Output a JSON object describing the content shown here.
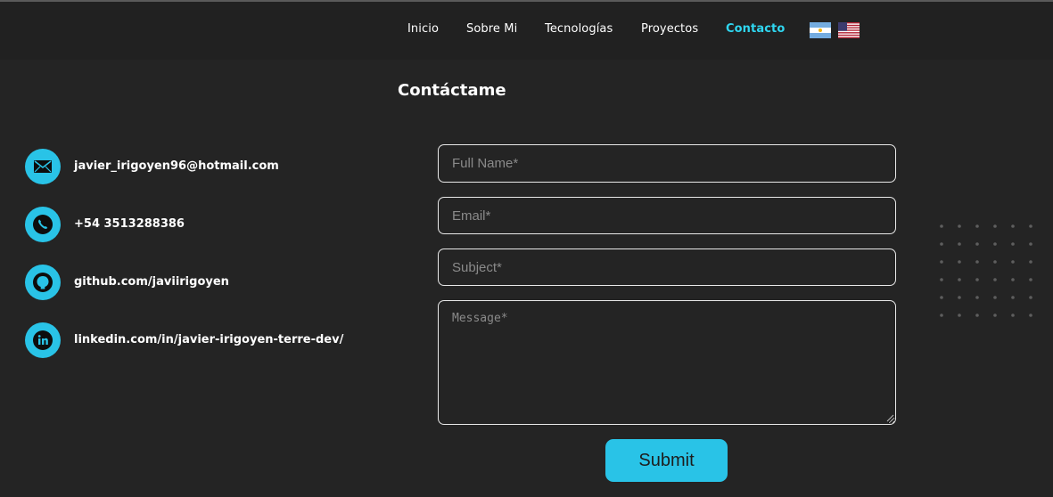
{
  "nav": {
    "links": [
      {
        "label": "Inicio"
      },
      {
        "label": "Sobre Mi"
      },
      {
        "label": "Tecnologías"
      },
      {
        "label": "Proyectos"
      },
      {
        "label": "Contacto",
        "active": true
      }
    ],
    "flags": [
      {
        "icon": "argentina-flag-icon"
      },
      {
        "icon": "usa-flag-icon"
      }
    ]
  },
  "page": {
    "title": "Contáctame"
  },
  "contacts": [
    {
      "icon": "email-icon",
      "text": "javier_irigoyen96@hotmail.com"
    },
    {
      "icon": "phone-icon",
      "text": "+54 3513288386"
    },
    {
      "icon": "github-icon",
      "text": "github.com/javiirigoyen"
    },
    {
      "icon": "linkedin-icon",
      "text": "linkedin.com/in/javier-irigoyen-terre-dev/"
    }
  ],
  "form": {
    "full_name": {
      "placeholder": "Full Name*",
      "value": ""
    },
    "email": {
      "placeholder": "Email*",
      "value": ""
    },
    "subject": {
      "placeholder": "Subject*",
      "value": ""
    },
    "message": {
      "placeholder": "Message*",
      "value": ""
    },
    "submit_label": "Submit"
  },
  "colors": {
    "accent": "#29c3e7",
    "active_link": "#2fd6f0",
    "background": "#242424",
    "navbar": "#212121"
  }
}
